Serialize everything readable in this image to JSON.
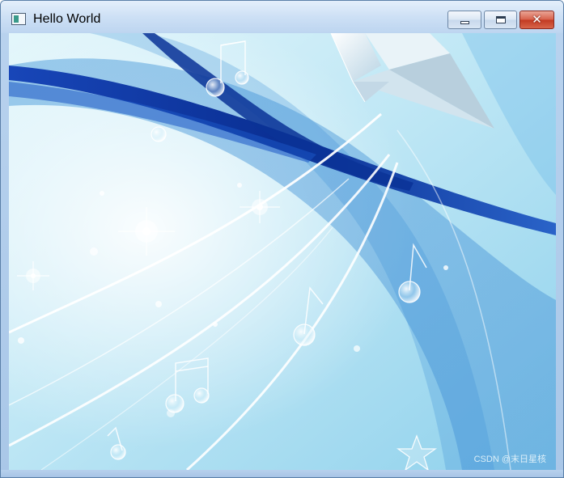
{
  "window": {
    "title": "Hello World",
    "app_icon": "window-app-icon",
    "controls": {
      "minimize": "minimize-icon",
      "maximize": "maximize-icon",
      "close": "close-icon",
      "close_glyph": "✕"
    }
  },
  "background_image": {
    "description_icons": [
      "music-note-icon",
      "bubble-icon",
      "star-icon",
      "paper-crane-icon"
    ],
    "colors": {
      "sky": "#c9ecf7",
      "wave_dark": "#0f3fae",
      "wave_light": "#6fb6e6",
      "highlight": "#ffffff"
    },
    "watermark": "CSDN @末日星核"
  }
}
